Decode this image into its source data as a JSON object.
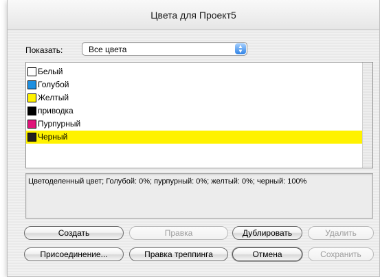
{
  "window": {
    "title": "Цвета для Проект5"
  },
  "show": {
    "label": "Показать:",
    "value": "Все цвета"
  },
  "colors": [
    {
      "name": "Белый",
      "swatch": "#ffffff"
    },
    {
      "name": "Голубой",
      "swatch": "#1d8fe0"
    },
    {
      "name": "Желтый",
      "swatch": "#fff200"
    },
    {
      "name": "приводка",
      "swatch": "#000000"
    },
    {
      "name": "Пурпурный",
      "swatch": "#e0147a"
    },
    {
      "name": "Черный",
      "swatch": "#231f20",
      "selected": true
    }
  ],
  "info": {
    "text": "Цветоделенный цвет; Голубой: 0%; пурпурный: 0%; желтый: 0%; черный: 100%"
  },
  "buttons": {
    "create": "Создать",
    "edit": "Правка",
    "duplicate": "Дублировать",
    "delete": "Удалить",
    "merge": "Присоединение...",
    "trapping": "Правка треппинга",
    "cancel": "Отмена",
    "save": "Сохранить"
  }
}
